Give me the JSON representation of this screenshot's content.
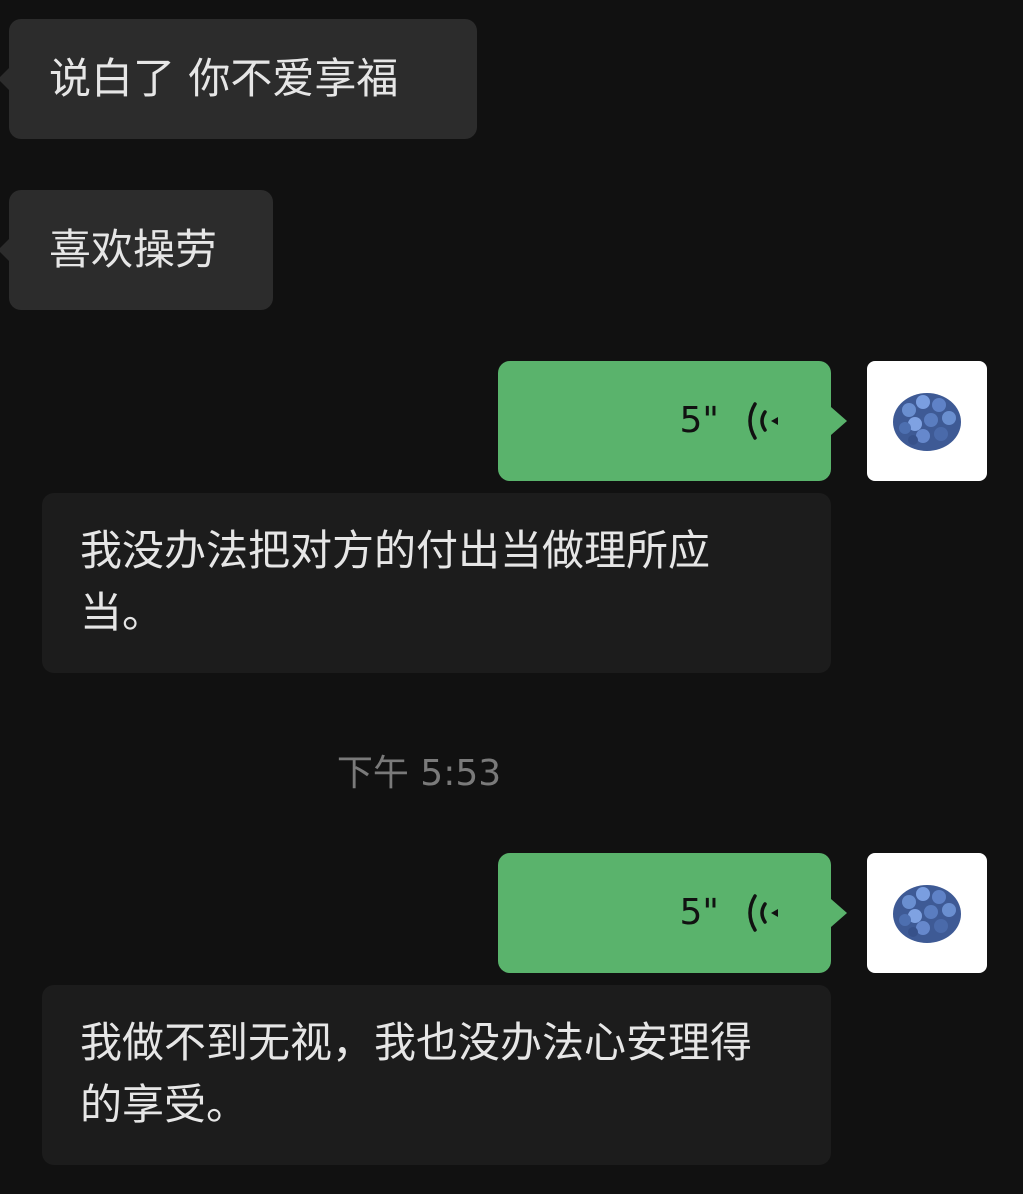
{
  "messages": [
    {
      "text": "说白了 你不爱享福"
    },
    {
      "text": "喜欢操劳"
    }
  ],
  "voice_messages": [
    {
      "duration": "5\"",
      "transcript": "我没办法把对方的付出当做理所应当。"
    },
    {
      "duration": "5\"",
      "transcript": "我做不到无视，我也没办法心安理得的享受。"
    }
  ],
  "timestamp": "下午 5:53",
  "colors": {
    "background": "#111111",
    "incoming_bubble": "#2c2c2c",
    "outgoing_voice_bubble": "#5ab36c",
    "transcript_box": "#1c1c1c"
  },
  "icons": {
    "voice": "voice-wave-icon",
    "avatar": "hydrangea-avatar"
  }
}
